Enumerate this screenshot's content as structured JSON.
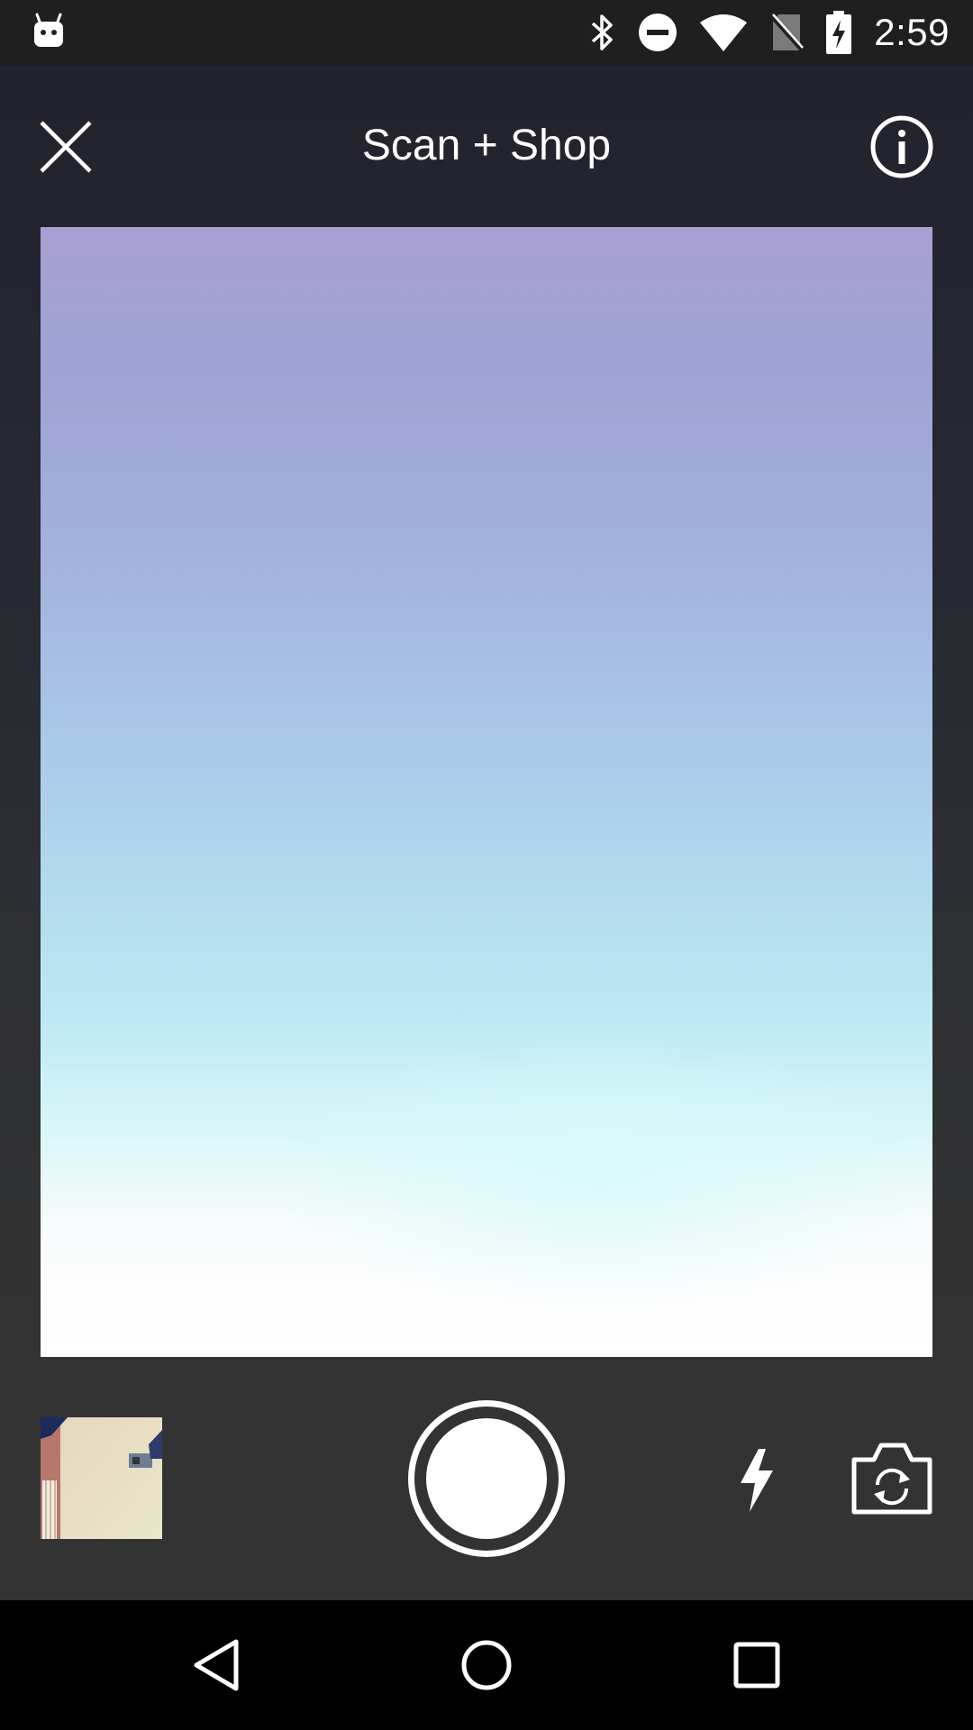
{
  "status_bar": {
    "time": "2:59",
    "icons": [
      "android-notification-icon",
      "bluetooth-icon",
      "do-not-disturb-icon",
      "wifi-icon",
      "no-sim-icon",
      "battery-charging-icon"
    ]
  },
  "app_bar": {
    "title": "Scan + Shop",
    "close_icon": "close-icon",
    "info_icon": "info-icon"
  },
  "viewfinder": {
    "description_colors": [
      "#a99fd2",
      "#a8c3e6",
      "#bde8f3",
      "#ffffff"
    ]
  },
  "controls": {
    "gallery_icon": "gallery-thumbnail",
    "shutter_icon": "shutter-icon",
    "flash_icon": "flash-icon",
    "flip_camera_icon": "flip-camera-icon"
  },
  "nav_bar": {
    "back_icon": "back-icon",
    "home_icon": "home-icon",
    "recents_icon": "recents-icon"
  }
}
